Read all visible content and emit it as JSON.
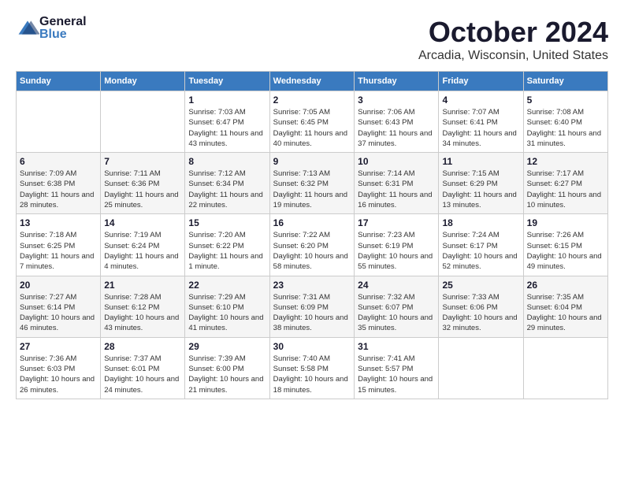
{
  "logo": {
    "general": "General",
    "blue": "Blue"
  },
  "header": {
    "month": "October 2024",
    "location": "Arcadia, Wisconsin, United States"
  },
  "weekdays": [
    "Sunday",
    "Monday",
    "Tuesday",
    "Wednesday",
    "Thursday",
    "Friday",
    "Saturday"
  ],
  "weeks": [
    [
      {
        "day": "",
        "sunrise": "",
        "sunset": "",
        "daylight": ""
      },
      {
        "day": "",
        "sunrise": "",
        "sunset": "",
        "daylight": ""
      },
      {
        "day": "1",
        "sunrise": "Sunrise: 7:03 AM",
        "sunset": "Sunset: 6:47 PM",
        "daylight": "Daylight: 11 hours and 43 minutes."
      },
      {
        "day": "2",
        "sunrise": "Sunrise: 7:05 AM",
        "sunset": "Sunset: 6:45 PM",
        "daylight": "Daylight: 11 hours and 40 minutes."
      },
      {
        "day": "3",
        "sunrise": "Sunrise: 7:06 AM",
        "sunset": "Sunset: 6:43 PM",
        "daylight": "Daylight: 11 hours and 37 minutes."
      },
      {
        "day": "4",
        "sunrise": "Sunrise: 7:07 AM",
        "sunset": "Sunset: 6:41 PM",
        "daylight": "Daylight: 11 hours and 34 minutes."
      },
      {
        "day": "5",
        "sunrise": "Sunrise: 7:08 AM",
        "sunset": "Sunset: 6:40 PM",
        "daylight": "Daylight: 11 hours and 31 minutes."
      }
    ],
    [
      {
        "day": "6",
        "sunrise": "Sunrise: 7:09 AM",
        "sunset": "Sunset: 6:38 PM",
        "daylight": "Daylight: 11 hours and 28 minutes."
      },
      {
        "day": "7",
        "sunrise": "Sunrise: 7:11 AM",
        "sunset": "Sunset: 6:36 PM",
        "daylight": "Daylight: 11 hours and 25 minutes."
      },
      {
        "day": "8",
        "sunrise": "Sunrise: 7:12 AM",
        "sunset": "Sunset: 6:34 PM",
        "daylight": "Daylight: 11 hours and 22 minutes."
      },
      {
        "day": "9",
        "sunrise": "Sunrise: 7:13 AM",
        "sunset": "Sunset: 6:32 PM",
        "daylight": "Daylight: 11 hours and 19 minutes."
      },
      {
        "day": "10",
        "sunrise": "Sunrise: 7:14 AM",
        "sunset": "Sunset: 6:31 PM",
        "daylight": "Daylight: 11 hours and 16 minutes."
      },
      {
        "day": "11",
        "sunrise": "Sunrise: 7:15 AM",
        "sunset": "Sunset: 6:29 PM",
        "daylight": "Daylight: 11 hours and 13 minutes."
      },
      {
        "day": "12",
        "sunrise": "Sunrise: 7:17 AM",
        "sunset": "Sunset: 6:27 PM",
        "daylight": "Daylight: 11 hours and 10 minutes."
      }
    ],
    [
      {
        "day": "13",
        "sunrise": "Sunrise: 7:18 AM",
        "sunset": "Sunset: 6:25 PM",
        "daylight": "Daylight: 11 hours and 7 minutes."
      },
      {
        "day": "14",
        "sunrise": "Sunrise: 7:19 AM",
        "sunset": "Sunset: 6:24 PM",
        "daylight": "Daylight: 11 hours and 4 minutes."
      },
      {
        "day": "15",
        "sunrise": "Sunrise: 7:20 AM",
        "sunset": "Sunset: 6:22 PM",
        "daylight": "Daylight: 11 hours and 1 minute."
      },
      {
        "day": "16",
        "sunrise": "Sunrise: 7:22 AM",
        "sunset": "Sunset: 6:20 PM",
        "daylight": "Daylight: 10 hours and 58 minutes."
      },
      {
        "day": "17",
        "sunrise": "Sunrise: 7:23 AM",
        "sunset": "Sunset: 6:19 PM",
        "daylight": "Daylight: 10 hours and 55 minutes."
      },
      {
        "day": "18",
        "sunrise": "Sunrise: 7:24 AM",
        "sunset": "Sunset: 6:17 PM",
        "daylight": "Daylight: 10 hours and 52 minutes."
      },
      {
        "day": "19",
        "sunrise": "Sunrise: 7:26 AM",
        "sunset": "Sunset: 6:15 PM",
        "daylight": "Daylight: 10 hours and 49 minutes."
      }
    ],
    [
      {
        "day": "20",
        "sunrise": "Sunrise: 7:27 AM",
        "sunset": "Sunset: 6:14 PM",
        "daylight": "Daylight: 10 hours and 46 minutes."
      },
      {
        "day": "21",
        "sunrise": "Sunrise: 7:28 AM",
        "sunset": "Sunset: 6:12 PM",
        "daylight": "Daylight: 10 hours and 43 minutes."
      },
      {
        "day": "22",
        "sunrise": "Sunrise: 7:29 AM",
        "sunset": "Sunset: 6:10 PM",
        "daylight": "Daylight: 10 hours and 41 minutes."
      },
      {
        "day": "23",
        "sunrise": "Sunrise: 7:31 AM",
        "sunset": "Sunset: 6:09 PM",
        "daylight": "Daylight: 10 hours and 38 minutes."
      },
      {
        "day": "24",
        "sunrise": "Sunrise: 7:32 AM",
        "sunset": "Sunset: 6:07 PM",
        "daylight": "Daylight: 10 hours and 35 minutes."
      },
      {
        "day": "25",
        "sunrise": "Sunrise: 7:33 AM",
        "sunset": "Sunset: 6:06 PM",
        "daylight": "Daylight: 10 hours and 32 minutes."
      },
      {
        "day": "26",
        "sunrise": "Sunrise: 7:35 AM",
        "sunset": "Sunset: 6:04 PM",
        "daylight": "Daylight: 10 hours and 29 minutes."
      }
    ],
    [
      {
        "day": "27",
        "sunrise": "Sunrise: 7:36 AM",
        "sunset": "Sunset: 6:03 PM",
        "daylight": "Daylight: 10 hours and 26 minutes."
      },
      {
        "day": "28",
        "sunrise": "Sunrise: 7:37 AM",
        "sunset": "Sunset: 6:01 PM",
        "daylight": "Daylight: 10 hours and 24 minutes."
      },
      {
        "day": "29",
        "sunrise": "Sunrise: 7:39 AM",
        "sunset": "Sunset: 6:00 PM",
        "daylight": "Daylight: 10 hours and 21 minutes."
      },
      {
        "day": "30",
        "sunrise": "Sunrise: 7:40 AM",
        "sunset": "Sunset: 5:58 PM",
        "daylight": "Daylight: 10 hours and 18 minutes."
      },
      {
        "day": "31",
        "sunrise": "Sunrise: 7:41 AM",
        "sunset": "Sunset: 5:57 PM",
        "daylight": "Daylight: 10 hours and 15 minutes."
      },
      {
        "day": "",
        "sunrise": "",
        "sunset": "",
        "daylight": ""
      },
      {
        "day": "",
        "sunrise": "",
        "sunset": "",
        "daylight": ""
      }
    ]
  ]
}
